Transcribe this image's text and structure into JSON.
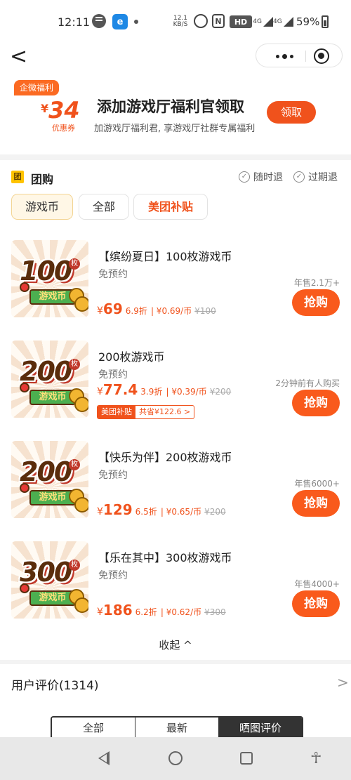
{
  "status_bar": {
    "time": "12:11",
    "app_icon": "e",
    "net_speed_value": "12.1",
    "net_speed_unit": "KB/S",
    "nfc": "N",
    "hd": "HD",
    "signal1": "4G",
    "signal2": "4G",
    "battery": "59%"
  },
  "nav": {
    "back_glyph": "<"
  },
  "promo": {
    "tag": "企微福利",
    "currency": "¥",
    "amount": "34",
    "coupon_label": "优惠券",
    "title": "添加游戏厅福利官领取",
    "subtitle": "加游戏厅福利君, 享游戏厅社群专属福利",
    "button": "领取"
  },
  "group_buy": {
    "icon_char": "团",
    "title": "团购",
    "flags": [
      "随时退",
      "过期退"
    ],
    "check_glyph": "✓",
    "categories": [
      "游戏币",
      "全部",
      "美团补贴"
    ],
    "deals": [
      {
        "thumb_number": "100",
        "thumb_mei": "枚",
        "thumb_label": "游戏币",
        "title": "【缤纷夏日】100枚游戏币",
        "note": "免预约",
        "currency": "¥",
        "price": "69",
        "discount": "6.9折",
        "unit_price": "| ¥0.69/币",
        "original": "¥100",
        "sales": "年售2.1万+",
        "button": "抢购"
      },
      {
        "thumb_number": "200",
        "thumb_mei": "枚",
        "thumb_label": "游戏币",
        "title": "200枚游戏币",
        "note": "免预约",
        "currency": "¥",
        "price": "77.4",
        "discount": "3.9折",
        "unit_price": "| ¥0.39/币",
        "original": "¥200",
        "sales": "2分钟前有人购买",
        "button": "抢购",
        "badge_label": "美团补贴",
        "badge_saving": "共省¥122.6 >"
      },
      {
        "thumb_number": "200",
        "thumb_mei": "枚",
        "thumb_label": "游戏币",
        "title": "【快乐为伴】200枚游戏币",
        "note": "免预约",
        "currency": "¥",
        "price": "129",
        "discount": "6.5折",
        "unit_price": "| ¥0.65/币",
        "original": "¥200",
        "sales": "年售6000+",
        "button": "抢购"
      },
      {
        "thumb_number": "300",
        "thumb_mei": "枚",
        "thumb_label": "游戏币",
        "title": "【乐在其中】300枚游戏币",
        "note": "免预约",
        "currency": "¥",
        "price": "186",
        "discount": "6.2折",
        "unit_price": "| ¥0.62/币",
        "original": "¥300",
        "sales": "年售4000+",
        "button": "抢购"
      }
    ],
    "collapse": "收起 ^"
  },
  "reviews": {
    "title": "用户评价(1314)",
    "arrow": ">",
    "tabs": [
      "全部",
      "最新",
      "晒图评价"
    ]
  },
  "system_nav": {
    "accessibility_glyph": "☥"
  },
  "colors": {
    "accent": "#f0521c",
    "buy_button": "#f95a1c"
  }
}
